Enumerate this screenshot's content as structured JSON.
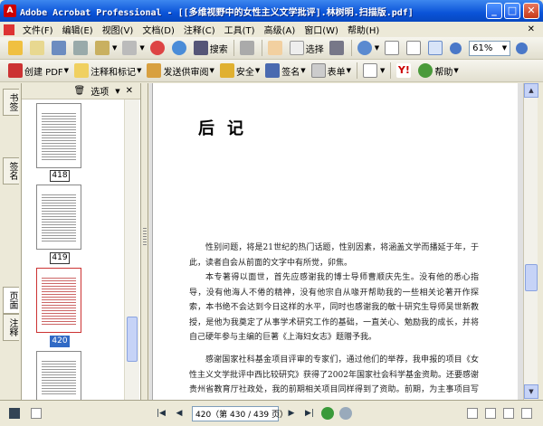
{
  "window": {
    "title": "Adobe Acrobat Professional - [[多维视野中的女性主义文学批评].林树明.扫描版.pdf]",
    "min_glyph": "_",
    "max_glyph": "□",
    "close_glyph": "✕"
  },
  "menu": {
    "items": [
      "文件(F)",
      "编辑(E)",
      "视图(V)",
      "文档(D)",
      "注释(C)",
      "工具(T)",
      "高级(A)",
      "窗口(W)",
      "帮助(H)"
    ],
    "close_glyph": "✕"
  },
  "toolbar1": {
    "search_label": "搜索",
    "select_label": "选择",
    "zoom_value": "61%"
  },
  "toolbar2": {
    "create_pdf": "创建 PDF",
    "comment_markup": "注释和标记",
    "send_review": "发送供审阅",
    "secure": "安全",
    "sign": "签名",
    "forms": "表单",
    "help": "帮助"
  },
  "navtabs": [
    "书签",
    "签名",
    "页面",
    "注释"
  ],
  "pages_panel": {
    "options_label": "选项",
    "close_glyph": "✕",
    "thumbnails": [
      {
        "label": "418",
        "selected": false
      },
      {
        "label": "419",
        "selected": false
      },
      {
        "label": "420",
        "selected": true
      },
      {
        "label": "",
        "selected": false
      }
    ]
  },
  "document": {
    "heading": "后记",
    "paragraphs": [
      "性别问题，将是21世纪的热门话题，性别因素，将涵盖文学而播延于年，于此，读者自会从前面的文字中有所觉，卯焦。",
      "本专著得以面世，首先应感谢我的博士导师曹顺庆先生。没有他的悉心指导，没有他海人不倦的精神，没有他宗自从喙开帮助我的一些相关论著开作探索，本书绝不会达到今日这样的水平，同时也感谢我的敏十研究生导师吴世新教授，是他为我奠定了从事学术研究工作的基础，一直关心、勉励我的成长，并将自己硬年参与主编的巨著《上海妇女志》题赠予我。",
      "感谢国家社科基金项目评审的专家们，通过他们的举荐，我申报的项目《女性主义文学批评中西比较研究》获得了2002年国家社会科学基金资助。还要感谢贵州省教育厅社政处，我的前期相关项目同样得到了资助。前期，为主事项目写作的一些项目与项目是研究结果等。"
    ]
  },
  "statusbar": {
    "page_value": "420（第 430 / 439 页）"
  }
}
